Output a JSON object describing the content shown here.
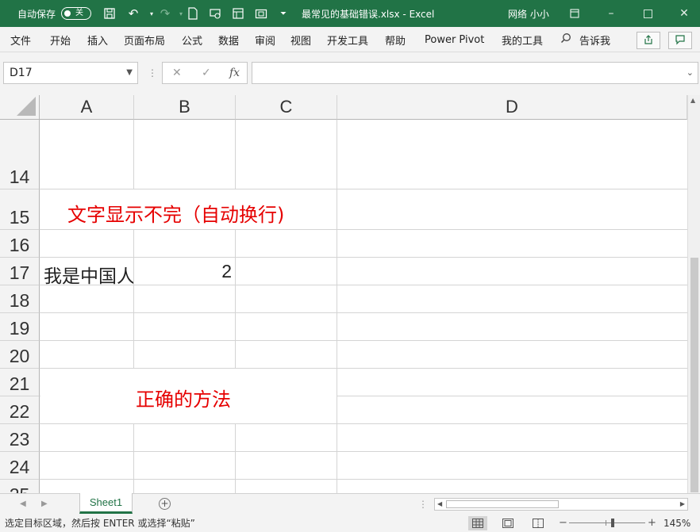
{
  "titlebar": {
    "autosave_label": "自动保存",
    "autosave_state": "关",
    "doc_title": "最常见的基础错误.xlsx  -  Excel",
    "user_name": "网络 小小",
    "accent": "#217346"
  },
  "ribbon": {
    "tabs": [
      "文件",
      "开始",
      "插入",
      "页面布局",
      "公式",
      "数据",
      "审阅",
      "视图",
      "开发工具",
      "帮助",
      "Power Pivot",
      "我的工具"
    ],
    "search_label": "告诉我"
  },
  "formula_bar": {
    "name_box": "D17",
    "formula": ""
  },
  "grid": {
    "columns": [
      "A",
      "B",
      "C",
      "D"
    ],
    "rows": [
      "14",
      "15",
      "16",
      "17",
      "18",
      "19",
      "20",
      "21",
      "22",
      "23",
      "24",
      "25"
    ],
    "cells": {
      "A17": "我是中国人",
      "B17": "2",
      "note_wrap": "文字显示不完（自动换行)",
      "note_method": "正确的方法"
    },
    "note_color": "#e60000"
  },
  "sheets": {
    "tabs": [
      "Sheet1"
    ],
    "active": "Sheet1"
  },
  "statusbar": {
    "message": "选定目标区域，然后按 ENTER 或选择“粘贴”",
    "zoom": "145%",
    "zoom_value": 145
  }
}
